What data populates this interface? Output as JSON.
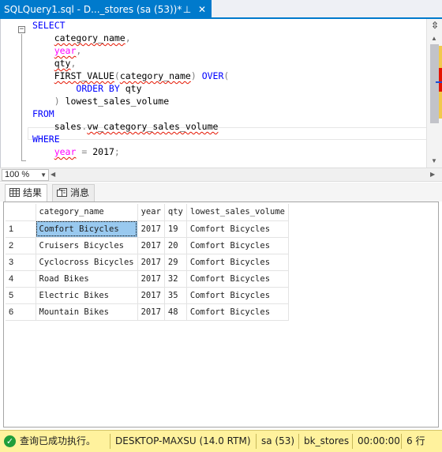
{
  "tab": {
    "title": "SQLQuery1.sql - D..._stores (sa (53))*",
    "pin_glyph": "⊥",
    "close_glyph": "✕"
  },
  "editor": {
    "lines": [
      [
        {
          "t": "SELECT",
          "c": "kw"
        }
      ],
      [
        {
          "t": "    "
        },
        {
          "t": "category_name",
          "c": "plain squig"
        },
        {
          "t": ",",
          "c": "gray"
        }
      ],
      [
        {
          "t": "    "
        },
        {
          "t": "year",
          "c": "fn squig"
        },
        {
          "t": ",",
          "c": "gray"
        }
      ],
      [
        {
          "t": "    "
        },
        {
          "t": "qty",
          "c": "plain squig"
        },
        {
          "t": ",",
          "c": "gray"
        }
      ],
      [
        {
          "t": "    "
        },
        {
          "t": "FIRST_VALUE",
          "c": "plain squig"
        },
        {
          "t": "(",
          "c": "gray"
        },
        {
          "t": "category_name",
          "c": "plain squig"
        },
        {
          "t": ")",
          "c": "gray"
        },
        {
          "t": " "
        },
        {
          "t": "OVER",
          "c": "kw"
        },
        {
          "t": "(",
          "c": "gray"
        }
      ],
      [
        {
          "t": "        "
        },
        {
          "t": "ORDER BY",
          "c": "kw"
        },
        {
          "t": " "
        },
        {
          "t": "qty",
          "c": "plain"
        }
      ],
      [
        {
          "t": "    "
        },
        {
          "t": ")",
          "c": "gray"
        },
        {
          "t": " "
        },
        {
          "t": "lowest_sales_volume",
          "c": "plain"
        }
      ],
      [
        {
          "t": "FROM",
          "c": "kw"
        }
      ],
      [
        {
          "t": "    "
        },
        {
          "t": "sales",
          "c": "plain"
        },
        {
          "t": ".",
          "c": "gray"
        },
        {
          "t": "vw_category_sales_volume",
          "c": "plain squig"
        }
      ],
      [
        {
          "t": "WHERE",
          "c": "kw"
        }
      ],
      [
        {
          "t": "    "
        },
        {
          "t": "year",
          "c": "fn squig"
        },
        {
          "t": " "
        },
        {
          "t": "=",
          "c": "gray"
        },
        {
          "t": " "
        },
        {
          "t": "2017",
          "c": "plain"
        },
        {
          "t": ";",
          "c": "gray"
        }
      ]
    ]
  },
  "zoom": {
    "value": "100 %"
  },
  "results_tabs": {
    "results_label": "结果",
    "messages_label": "消息"
  },
  "grid": {
    "columns": [
      "category_name",
      "year",
      "qty",
      "lowest_sales_volume"
    ],
    "rows": [
      [
        "1",
        "Comfort Bicycles",
        "2017",
        "19",
        "Comfort Bicycles"
      ],
      [
        "2",
        "Cruisers Bicycles",
        "2017",
        "20",
        "Comfort Bicycles"
      ],
      [
        "3",
        "Cyclocross Bicycles",
        "2017",
        "29",
        "Comfort Bicycles"
      ],
      [
        "4",
        "Road Bikes",
        "2017",
        "32",
        "Comfort Bicycles"
      ],
      [
        "5",
        "Electric Bikes",
        "2017",
        "35",
        "Comfort Bicycles"
      ],
      [
        "6",
        "Mountain Bikes",
        "2017",
        "48",
        "Comfort Bicycles"
      ]
    ]
  },
  "status": {
    "message": "查询已成功执行。",
    "server": "DESKTOP-MAXSU (14.0 RTM)",
    "user": "sa (53)",
    "database": "bk_stores",
    "elapsed": "00:00:00",
    "rows": "6 行"
  },
  "colors": {
    "accent": "#007acc",
    "status_bg": "#fff29d",
    "selection": "#99c9ef",
    "keyword": "#0000ff",
    "function": "#ff00ff"
  }
}
